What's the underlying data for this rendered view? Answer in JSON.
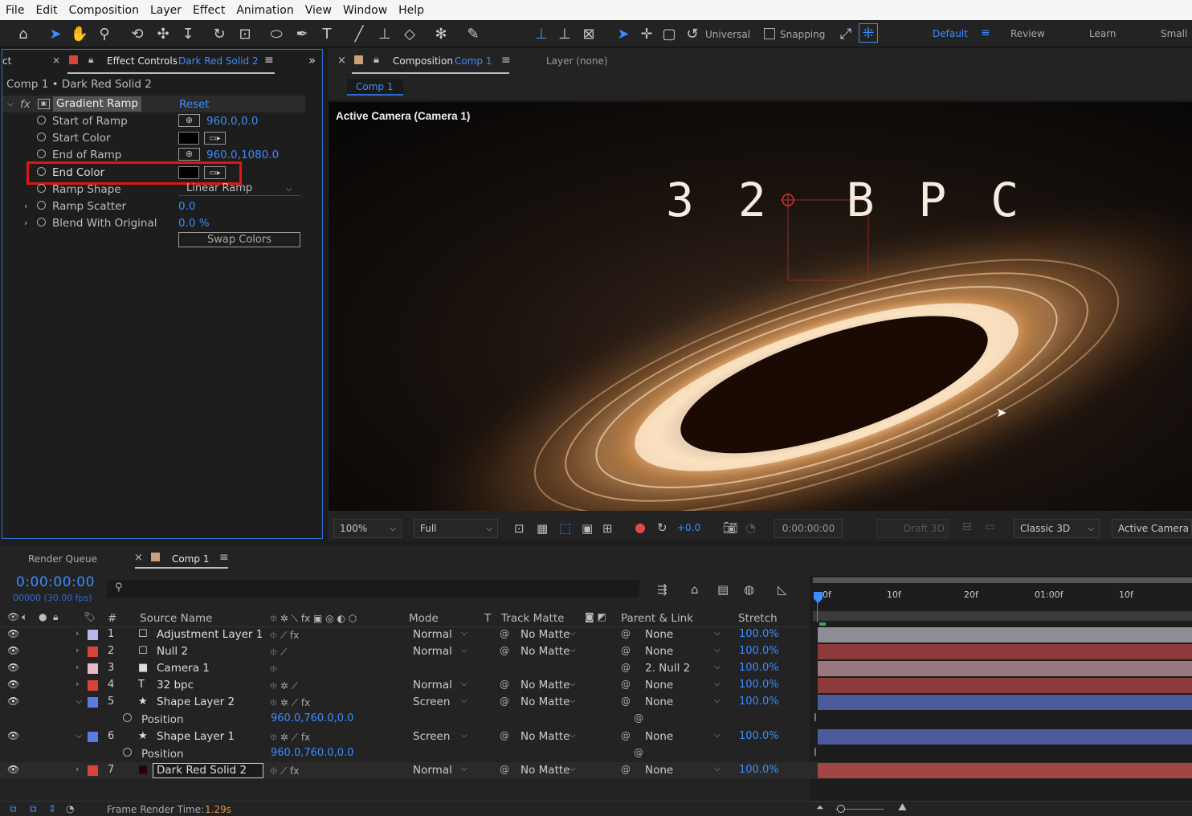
{
  "menu": [
    "File",
    "Edit",
    "Composition",
    "Layer",
    "Effect",
    "Animation",
    "View",
    "Window",
    "Help"
  ],
  "toolbar": {
    "universal": "Universal",
    "snapping": "Snapping",
    "workspaces": [
      "Default",
      "Review",
      "Learn",
      "Small"
    ]
  },
  "effect_controls": {
    "tab_prefix": "ct",
    "tab_title": "Effect Controls",
    "tab_layer": "Dark Red Solid 2",
    "breadcrumb": "Comp 1 • Dark Red Solid 2",
    "effect_name": "Gradient Ramp",
    "reset": "Reset",
    "props": [
      {
        "name": "Start of Ramp",
        "value": "960.0,0.0"
      },
      {
        "name": "Start Color",
        "value": ""
      },
      {
        "name": "End of Ramp",
        "value": "960.0,1080.0"
      },
      {
        "name": "End Color",
        "value": ""
      },
      {
        "name": "Ramp Shape",
        "value": "Linear Ramp"
      },
      {
        "name": "Ramp Scatter",
        "value": "0.0"
      },
      {
        "name": "Blend With Original",
        "value": "0.0 %"
      }
    ],
    "swap": "Swap Colors"
  },
  "composition": {
    "tab_title": "Composition",
    "tab_comp": "Comp 1",
    "layer_panel": "Layer (none)",
    "subtab": "Comp 1",
    "camera_label": "Active Camera (Camera 1)",
    "overlay_text": "3 2  B P C"
  },
  "viewer_bar": {
    "zoom": "100%",
    "resolution": "Full",
    "exposure": "+0.0",
    "timecode": "0:00:00:00",
    "draft": "Draft 3D",
    "renderer": "Classic 3D",
    "view": "Active Camera ..."
  },
  "timeline": {
    "render_queue": "Render Queue",
    "comp_tab": "Comp 1",
    "time": "0:00:00:00",
    "frames": "00000 (30.00 fps)",
    "frame_render_label": "Frame Render Time:",
    "frame_render_value": "1.29s",
    "headers": {
      "num": "#",
      "source": "Source Name",
      "mode": "Mode",
      "t": "T",
      "trackmatte": "Track Matte",
      "parent": "Parent & Link",
      "stretch": "Stretch"
    },
    "ruler": [
      "0f",
      "10f",
      "20f",
      "01:00f",
      "10f"
    ],
    "layers": [
      {
        "num": "1",
        "name": "Adjustment Layer 1",
        "mode": "Normal",
        "matte": "No Matte",
        "parent": "None",
        "stretch": "100.0%",
        "label": "#b7b7e8",
        "bar": "#8d8d96"
      },
      {
        "num": "2",
        "name": "Null 2",
        "mode": "Normal",
        "matte": "No Matte",
        "parent": "None",
        "stretch": "100.0%",
        "label": "#d9443a",
        "bar": "#8c3a3a"
      },
      {
        "num": "3",
        "name": "Camera 1",
        "mode": "",
        "matte": "",
        "parent": "2. Null 2",
        "stretch": "100.0%",
        "label": "#e6b8c8",
        "bar": "#9a7880"
      },
      {
        "num": "4",
        "name": "32 bpc",
        "mode": "Normal",
        "matte": "No Matte",
        "parent": "None",
        "stretch": "100.0%",
        "label": "#d9443a",
        "bar": "#8c3a3a"
      },
      {
        "num": "5",
        "name": "Shape Layer 2",
        "mode": "Screen",
        "matte": "No Matte",
        "parent": "None",
        "stretch": "100.0%",
        "label": "#5c7de0",
        "bar": "#4b5b9c"
      },
      {
        "num": "6",
        "name": "Shape Layer 1",
        "mode": "Screen",
        "matte": "No Matte",
        "parent": "None",
        "stretch": "100.0%",
        "label": "#5c7de0",
        "bar": "#4b5b9c"
      },
      {
        "num": "7",
        "name": "Dark Red Solid 2",
        "mode": "Normal",
        "matte": "No Matte",
        "parent": "None",
        "stretch": "100.0%",
        "label": "#d9443a",
        "bar": "#a24545"
      }
    ],
    "position_label": "Position",
    "position_value": "960.0,760.0,0.0"
  }
}
